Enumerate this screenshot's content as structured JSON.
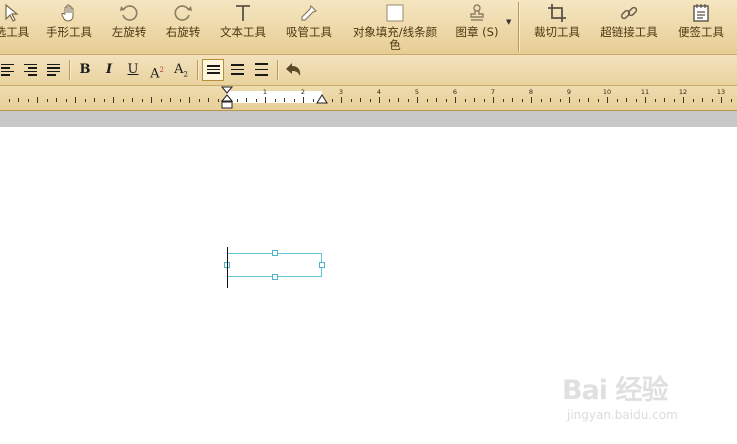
{
  "toolbar": {
    "tools": [
      {
        "id": "select",
        "label": "选工具"
      },
      {
        "id": "hand",
        "label": "手形工具"
      },
      {
        "id": "rotate-left",
        "label": "左旋转"
      },
      {
        "id": "rotate-right",
        "label": "右旋转"
      },
      {
        "id": "text",
        "label": "文本工具"
      },
      {
        "id": "eyedropper",
        "label": "吸管工具"
      },
      {
        "id": "fill",
        "label": "对象填充/线条颜",
        "label2": "色"
      },
      {
        "id": "stamp",
        "label": "图章 (S)"
      },
      {
        "id": "crop",
        "label": "裁切工具"
      },
      {
        "id": "hyperlink",
        "label": "超链接工具"
      },
      {
        "id": "note",
        "label": "便签工具"
      }
    ]
  },
  "format": {
    "bold": "B",
    "italic": "I",
    "underline": "U",
    "superscript": "A",
    "superscript_mark": "2",
    "subscript": "A",
    "subscript_mark": "2"
  },
  "ruler": {
    "numbers": [
      "1",
      "2",
      "3",
      "4",
      "5",
      "6",
      "7",
      "8",
      "9",
      "10",
      "11",
      "12",
      "13"
    ]
  },
  "watermark": {
    "logo": "Bai 经验",
    "url": "jingyan.baidu.com"
  },
  "colors": {
    "toolbar_bg": "#edd8a8",
    "selection_border": "#5fc7d6"
  }
}
